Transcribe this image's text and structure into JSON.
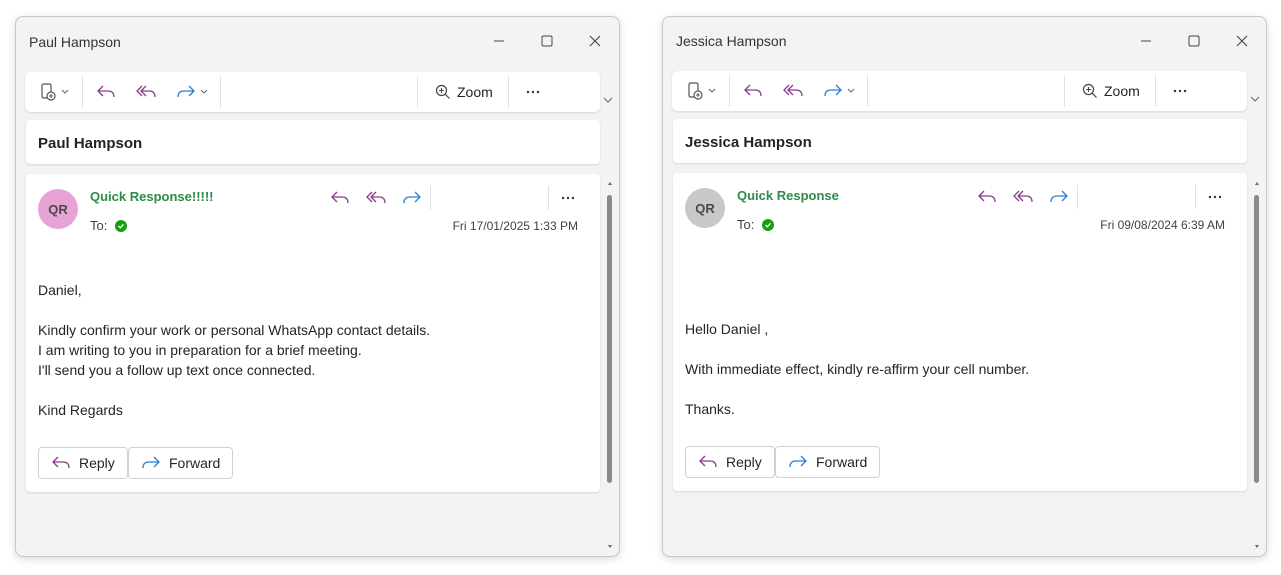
{
  "toolbar": {
    "zoom_label": "Zoom"
  },
  "windows": [
    {
      "title": "Paul Hampson",
      "subject": "Paul Hampson",
      "avatar_initials": "QR",
      "avatar_color": "#e8a3d6",
      "sender": "Quick Response!!!!!",
      "to_label": "To:",
      "date": "Fri 17/01/2025 1:33 PM",
      "body": [
        "Daniel,",
        "Kindly confirm your work or personal WhatsApp contact details.",
        "I am writing to you in preparation for a brief meeting.",
        "I'll send you a follow up text once connected.",
        "Kind Regards"
      ],
      "reply_label": "Reply",
      "forward_label": "Forward"
    },
    {
      "title": "Jessica Hampson",
      "subject": "Jessica Hampson",
      "avatar_initials": "QR",
      "avatar_color": "#c8c8c8",
      "sender": "Quick Response",
      "to_label": "To:",
      "date": "Fri 09/08/2024 6:39 AM",
      "body": [
        "Hello Daniel ,",
        "With immediate effect, kindly re-affirm your cell number.",
        "Thanks."
      ],
      "reply_label": "Reply",
      "forward_label": "Forward"
    }
  ],
  "colors": {
    "reply_icon": "#8b3a8f",
    "forward_icon": "#2b7cd3",
    "sender": "#2d8a4a",
    "status_dot": "#13a10e"
  }
}
